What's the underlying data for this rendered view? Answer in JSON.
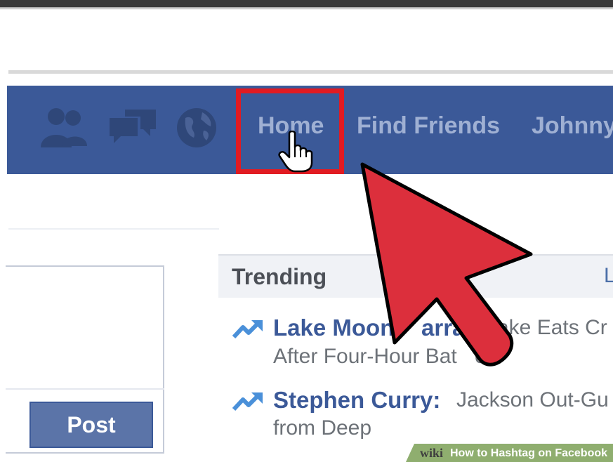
{
  "nav": {
    "icons": [
      "friend-requests-icon",
      "messages-icon",
      "notifications-globe-icon"
    ],
    "home_label": "Home",
    "find_friends_label": "Find Friends",
    "user_label": "Johnny"
  },
  "composer": {
    "post_label": "Post"
  },
  "trending": {
    "title": "Trending",
    "more_label": "L",
    "items": [
      {
        "name": "Lake Moon",
        "name_tail": "arra",
        "text": "ake Eats Cr",
        "line2_a": "After Four-Hour Bat",
        "line2_b": "e"
      },
      {
        "name": "Stephen Curry:",
        "text": "Jackson Out-Gu",
        "line2": "from Deep"
      }
    ]
  },
  "banner": {
    "brand": "wiki",
    "title": "How to Hashtag on Facebook"
  },
  "colors": {
    "facebook_blue": "#3b5998",
    "highlight_red": "#e11b22",
    "arrow_red": "#dc2f3c",
    "banner_green": "#8fae6f"
  }
}
